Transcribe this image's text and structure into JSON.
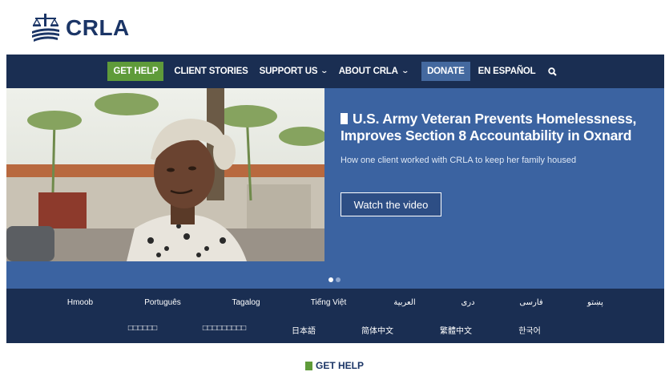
{
  "brand": {
    "name": "CRLA",
    "logo_icon": "scales-of-justice-icon",
    "color": "#1b3566"
  },
  "nav": {
    "get_help": "GET HELP",
    "client_stories": "CLIENT STORIES",
    "support_us": "SUPPORT US",
    "about": "ABOUT CRLA",
    "donate": "DONATE",
    "espanol": "EN ESPAÑOL",
    "search_icon": "search-icon"
  },
  "hero": {
    "title": "U.S. Army Veteran Prevents Homelessness, Improves Section 8 Accountability in Oxnard",
    "subtitle": "How one client worked with CRLA to keep her family housed",
    "button": "Watch the video",
    "slides_total": 2,
    "slide_active": 1
  },
  "languages": {
    "row1": [
      "Hmoob",
      "Português",
      "Tagalog",
      "Tiếng Việt",
      "العربية",
      "دری",
      "فارسی",
      "پښتو"
    ],
    "row2": [
      "□□□□□□",
      "□□□□□□□□□",
      "日本語",
      "简体中文",
      "繁體中文",
      "한국어"
    ]
  },
  "footer": {
    "get_help": "GET HELP"
  },
  "colors": {
    "navy": "#1a2e52",
    "hero_blue": "#3b63a1",
    "green": "#5f9b3a",
    "donate": "#44699f"
  }
}
